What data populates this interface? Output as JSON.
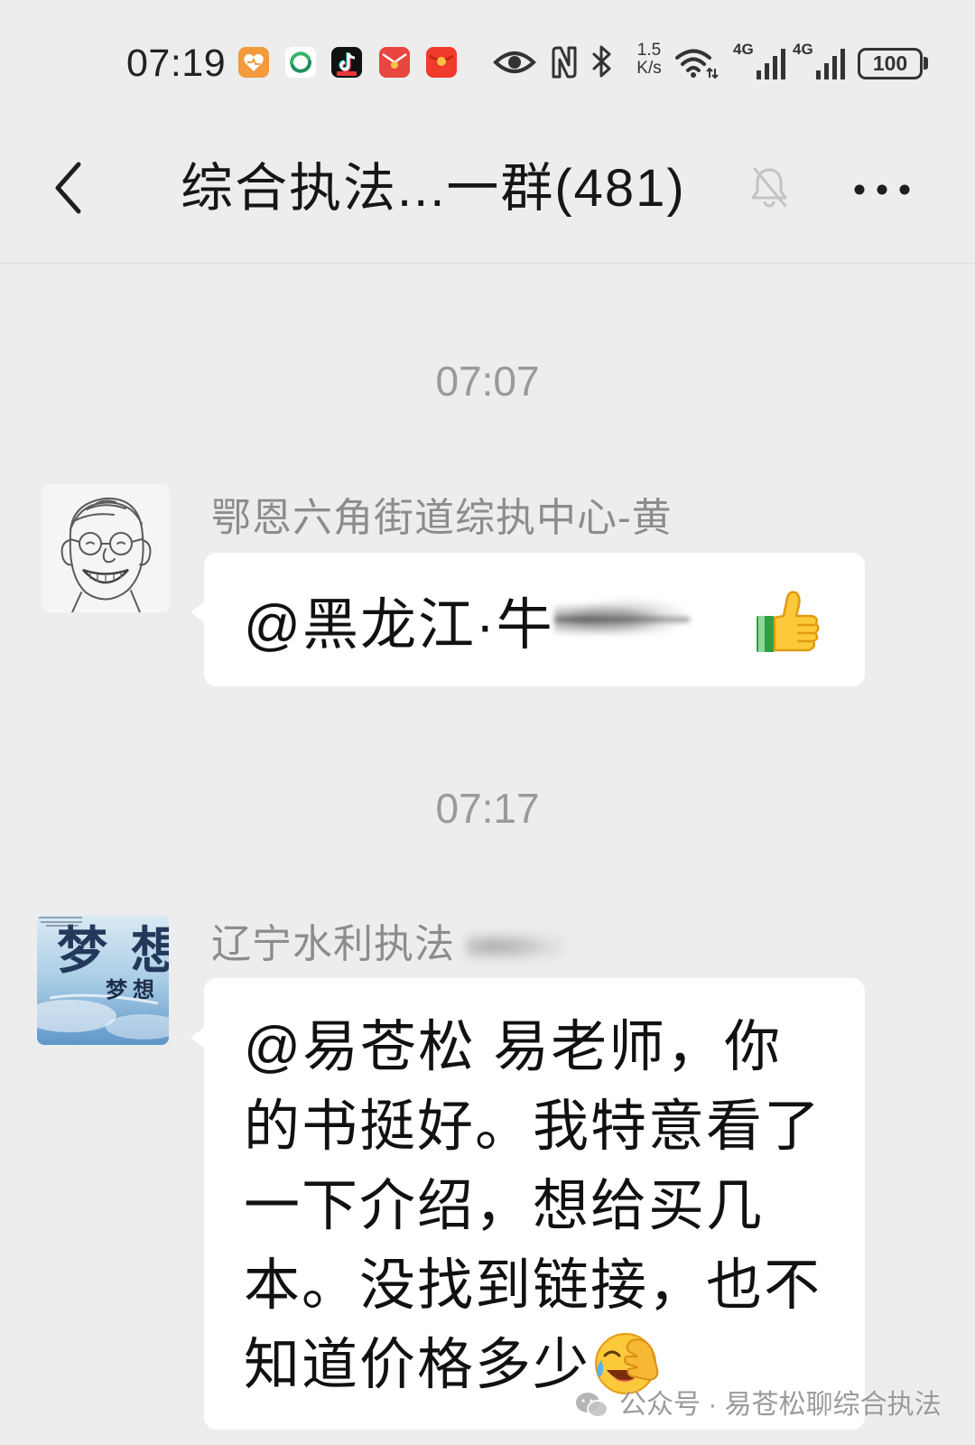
{
  "colors": {
    "background": "#ededed",
    "bubble": "#ffffff",
    "sender_name": "#8c8c8c",
    "timestamp": "#9a9a9a",
    "message_text": "#111111"
  },
  "status_bar": {
    "time": "07:19",
    "notification_icons": [
      "heart-app-icon",
      "green-swirl-app-icon",
      "tiktok-icon",
      "red-envelope-icon",
      "red-packet-icon"
    ],
    "system_icons": [
      "eye-icon",
      "nfc-icon",
      "bluetooth-icon",
      "wifi-icon"
    ],
    "network_speed": {
      "value": "1.5",
      "unit": "K/s"
    },
    "signals": [
      {
        "label": "4G",
        "bars": 4
      },
      {
        "label": "4G",
        "bars": 4
      }
    ],
    "battery": "100"
  },
  "header": {
    "back_icon": "chevron-left-icon",
    "title": "综合执法...一群(481)",
    "mute_icon": "bell-off-icon",
    "more_icon": "more-icon"
  },
  "chat": {
    "groups": [
      {
        "time": "07:07",
        "message": {
          "avatar_icon": "sketch-portrait-avatar",
          "sender": "鄂恩六角街道综执中心-黄",
          "text": "@黑龙江·牛",
          "text_redacted": true,
          "emoji_icon": "thumbs-up-emoji-icon"
        }
      },
      {
        "time": "07:17",
        "message": {
          "avatar_icon": "dream-sky-avatar",
          "avatar_text": {
            "large": "梦想",
            "small": "梦想"
          },
          "sender": "辽宁水利执法",
          "sender_redacted": true,
          "lines": [
            "@易苍松  易老师，你",
            "的书挺好。我特意看了",
            "一下介绍，想给买几",
            "本。没找到链接，也不",
            "知道价格多少"
          ],
          "emoji_icon": "facepalm-emoji-icon"
        }
      }
    ]
  },
  "watermark": {
    "icon": "wechat-icon",
    "text": "公众号 · 易苍松聊综合执法"
  }
}
